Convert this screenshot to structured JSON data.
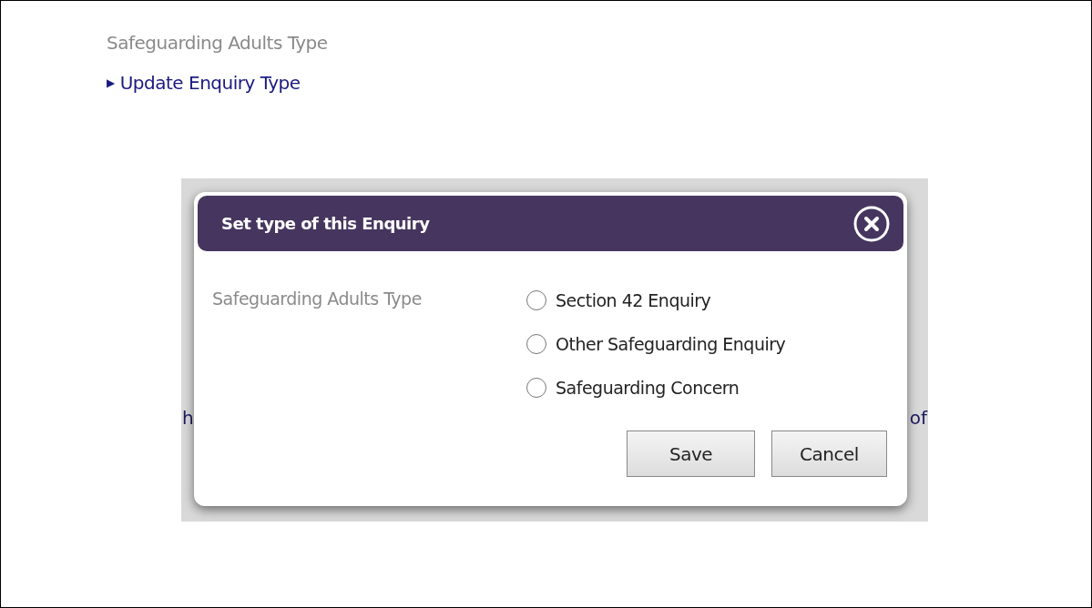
{
  "page": {
    "title": "Safeguarding Adults Type",
    "link": {
      "icon": "▶",
      "label": "Update Enquiry Type"
    },
    "background_fragments": [
      "h",
      "of"
    ]
  },
  "dialog": {
    "title": "Set type of this Enquiry",
    "field_label": "Safeguarding Adults Type",
    "options": [
      {
        "label": "Section 42 Enquiry",
        "selected": false
      },
      {
        "label": "Other Safeguarding Enquiry",
        "selected": false
      },
      {
        "label": "Safeguarding Concern",
        "selected": false
      }
    ],
    "buttons": [
      "Save",
      "Cancel"
    ]
  }
}
